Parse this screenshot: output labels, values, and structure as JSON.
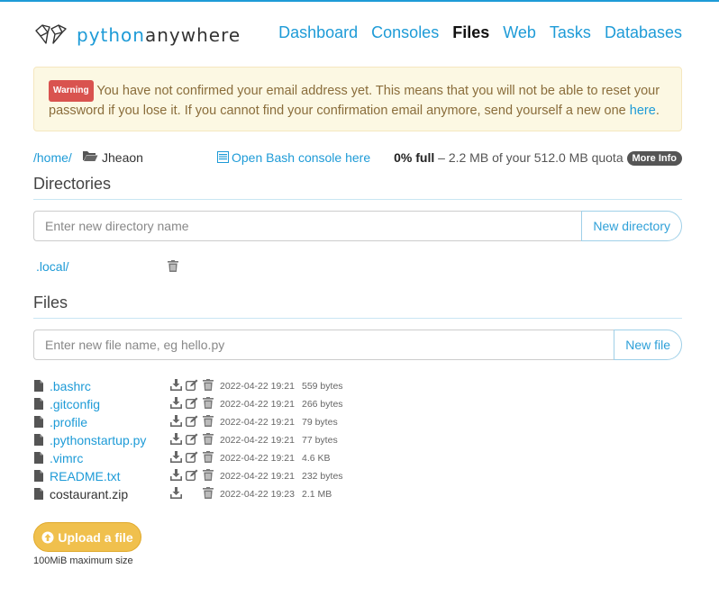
{
  "brand": {
    "prefix": "python",
    "suffix": "anywhere"
  },
  "nav": [
    {
      "label": "Dashboard",
      "active": false
    },
    {
      "label": "Consoles",
      "active": false
    },
    {
      "label": "Files",
      "active": true
    },
    {
      "label": "Web",
      "active": false
    },
    {
      "label": "Tasks",
      "active": false
    },
    {
      "label": "Databases",
      "active": false
    }
  ],
  "warning": {
    "badge": "Warning",
    "message": "You have not confirmed your email address yet. This means that you will not be able to reset your password if you lose it. If you cannot find your confirmation email anymore, send yourself a new one ",
    "link": "here",
    "end": "."
  },
  "path": {
    "root": "/home/",
    "user": "Jheaon"
  },
  "bash_link": "Open Bash console here",
  "quota": {
    "percent": "0% full",
    "detail": " – 2.2 MB of your 512.0 MB quota ",
    "more": "More Info"
  },
  "directories": {
    "title": "Directories",
    "placeholder": "Enter new directory name",
    "button": "New directory",
    "items": [
      ".local/"
    ]
  },
  "files": {
    "title": "Files",
    "placeholder": "Enter new file name, eg hello.py",
    "button": "New file",
    "items": [
      {
        "name": ".bashrc",
        "date": "2022-04-22 19:21",
        "size": "559 bytes",
        "editable": true
      },
      {
        "name": ".gitconfig",
        "date": "2022-04-22 19:21",
        "size": "266 bytes",
        "editable": true
      },
      {
        "name": ".profile",
        "date": "2022-04-22 19:21",
        "size": "79 bytes",
        "editable": true
      },
      {
        "name": ".pythonstartup.py",
        "date": "2022-04-22 19:21",
        "size": "77 bytes",
        "editable": true
      },
      {
        "name": ".vimrc",
        "date": "2022-04-22 19:21",
        "size": "4.6 KB",
        "editable": true
      },
      {
        "name": "README.txt",
        "date": "2022-04-22 19:21",
        "size": "232 bytes",
        "editable": true
      },
      {
        "name": "costaurant.zip",
        "date": "2022-04-22 19:23",
        "size": "2.1 MB",
        "editable": false
      }
    ]
  },
  "upload": {
    "button": "Upload a file",
    "note": "100MiB maximum size"
  },
  "colors": {
    "accent": "#1e9bd7",
    "warning_bg": "#fcf8e3",
    "warning_badge": "#d9534f",
    "upload": "#f0c04d"
  }
}
